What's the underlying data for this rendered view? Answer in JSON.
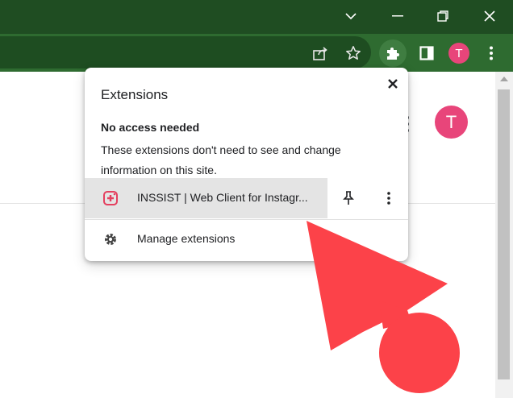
{
  "popup": {
    "title": "Extensions",
    "section_heading": "No access needed",
    "section_description": "These extensions don't need to see and change information on this site.",
    "extension": {
      "name": "INSSIST | Web Client for Instagr..."
    },
    "manage_label": "Manage extensions"
  },
  "profile": {
    "initial": "T"
  },
  "colors": {
    "titlebar": "#1f4d22",
    "toolbar": "#2e6b30",
    "avatar": "#e8457a",
    "annotation_arrow": "#fc4249"
  },
  "icons": [
    "chevron-down-icon",
    "minimize-icon",
    "restore-icon",
    "close-icon",
    "share-icon",
    "star-icon",
    "puzzle-icon",
    "side-panel-icon",
    "kebab-icon",
    "pin-icon",
    "gear-icon",
    "inssist-icon"
  ]
}
